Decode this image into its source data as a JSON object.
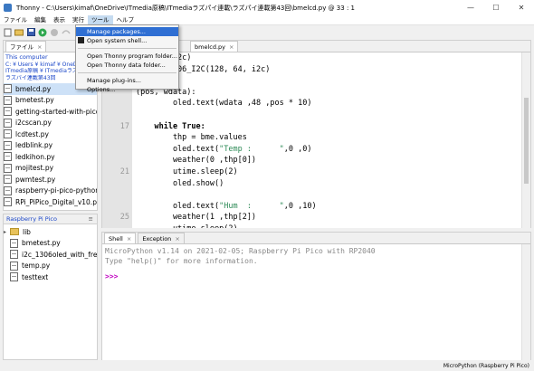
{
  "window": {
    "title": "Thonny  -  C:\\Users\\kimaf\\OneDrive\\ITmedia原稿\\ITmediaラズパイ連載\\ラズパイ連載第43回\\bmelcd.py  @  33 : 1"
  },
  "menu": [
    "ファイル",
    "編集",
    "表示",
    "実行",
    "ツール",
    "ヘルプ"
  ],
  "tools_menu": {
    "group1": [
      "Manage packages...",
      "Open system shell..."
    ],
    "group2": [
      "Open Thonny program folder...",
      "Open Thonny data folder..."
    ],
    "group3": [
      "Manage plug-ins...",
      "Options..."
    ]
  },
  "files_panel": {
    "tab": "ファイル",
    "section_title": "This computer",
    "path_lines": [
      "C: ¥ Users ¥ kimaf ¥ OneDr",
      "ITmedia原稿 ¥ ITmediaラズ",
      "ラズパイ連載第43回"
    ],
    "items": [
      "bmelcd.py",
      "bmetest.py",
      "getting-started-with-pico",
      "i2cscan.py",
      "lcdtest.py",
      "ledblink.py",
      "ledkihon.py",
      "mojitest.py",
      "pwmtest.py",
      "raspberry-pi-pico-python",
      "RPi_PiPico_Digital_v10.pd"
    ]
  },
  "pico_panel": {
    "title": "Raspberry Pi Pico",
    "menu_glyph": "≡",
    "items": [
      "lib",
      "bmetest.py",
      "i2c_1306oled_with_freq.p",
      "temp.py",
      "testtext"
    ]
  },
  "editor": {
    "tab": "bmelcd.py",
    "line_numbers": [
      "",
      "",
      "",
      "",
      "",
      "",
      "17",
      "",
      "",
      "",
      "21",
      "",
      "",
      "",
      "25"
    ],
    "lines": [
      [
        {
          "t": "e(i2c = i2c)",
          "c": ""
        }
      ],
      [
        {
          "t": "306.SSD1306_I2C(128, 64, i2c)",
          "c": ""
        }
      ],
      [
        {
          "t": "",
          "c": ""
        }
      ],
      [
        {
          "t": "(pos, wdata):",
          "c": ""
        }
      ],
      [
        {
          "t": "        oled.text(wdata ,48 ,pos * 10)",
          "c": ""
        }
      ],
      [
        {
          "t": "",
          "c": ""
        }
      ],
      [
        {
          "t": "    while True:",
          "c": "kw"
        }
      ],
      [
        {
          "t": "        thp = bme.values",
          "c": ""
        }
      ],
      [
        {
          "t": "        oled.text(",
          "c": ""
        },
        {
          "t": "\"Temp :      \"",
          "c": "str"
        },
        {
          "t": ",0 ,0)",
          "c": ""
        }
      ],
      [
        {
          "t": "        weather(0 ,thp[0])",
          "c": ""
        }
      ],
      [
        {
          "t": "        utime.sleep(2)",
          "c": ""
        }
      ],
      [
        {
          "t": "        oled.show()",
          "c": ""
        }
      ],
      [
        {
          "t": "",
          "c": ""
        }
      ],
      [
        {
          "t": "        oled.text(",
          "c": ""
        },
        {
          "t": "\"Hum  :      \"",
          "c": "str"
        },
        {
          "t": ",0 ,10)",
          "c": ""
        }
      ],
      [
        {
          "t": "        weather(1 ,thp[2])",
          "c": ""
        }
      ],
      [
        {
          "t": "        utime.sleep(2)",
          "c": ""
        }
      ],
      [
        {
          "t": "        oled.show()",
          "c": ""
        }
      ],
      [
        {
          "t": "",
          "c": ""
        }
      ],
      [
        {
          "t": "        oled.text(",
          "c": ""
        },
        {
          "t": "\"Press:      \"",
          "c": "str"
        },
        {
          "t": ",0 ,20)",
          "c": ""
        }
      ]
    ]
  },
  "shell": {
    "tabs": [
      "Shell",
      "Exception"
    ],
    "lines": [
      "MicroPython v1.14 on 2021-02-05; Raspberry Pi Pico with RP2040",
      "Type \"help()\" for more information."
    ],
    "prompt": ">>>"
  },
  "status": {
    "interpreter": "MicroPython (Raspberry Pi Pico)"
  },
  "colors": {
    "accent": "#2f6fd3",
    "path_link": "#1a46c8",
    "string": "#2e8b57"
  }
}
